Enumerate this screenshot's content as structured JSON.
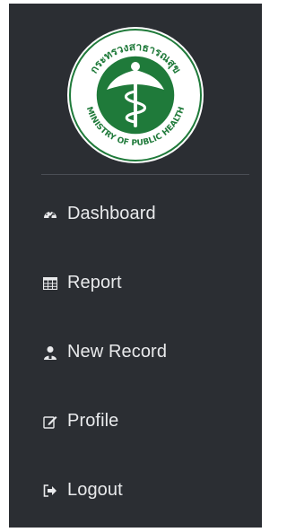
{
  "logo": {
    "top_text": "กระทรวงสาธารณสุข",
    "bottom_text": "MINISTRY OF PUBLIC HEALTH"
  },
  "menu": {
    "items": [
      {
        "label": "Dashboard",
        "icon": "dashboard-icon"
      },
      {
        "label": "Report",
        "icon": "table-icon"
      },
      {
        "label": "New Record",
        "icon": "user-icon"
      },
      {
        "label": "Profile",
        "icon": "edit-icon"
      },
      {
        "label": "Logout",
        "icon": "logout-icon"
      }
    ]
  },
  "colors": {
    "sidebar_bg": "#2b2e33",
    "text": "#e9eaec",
    "logo_green": "#1f7a3a"
  }
}
